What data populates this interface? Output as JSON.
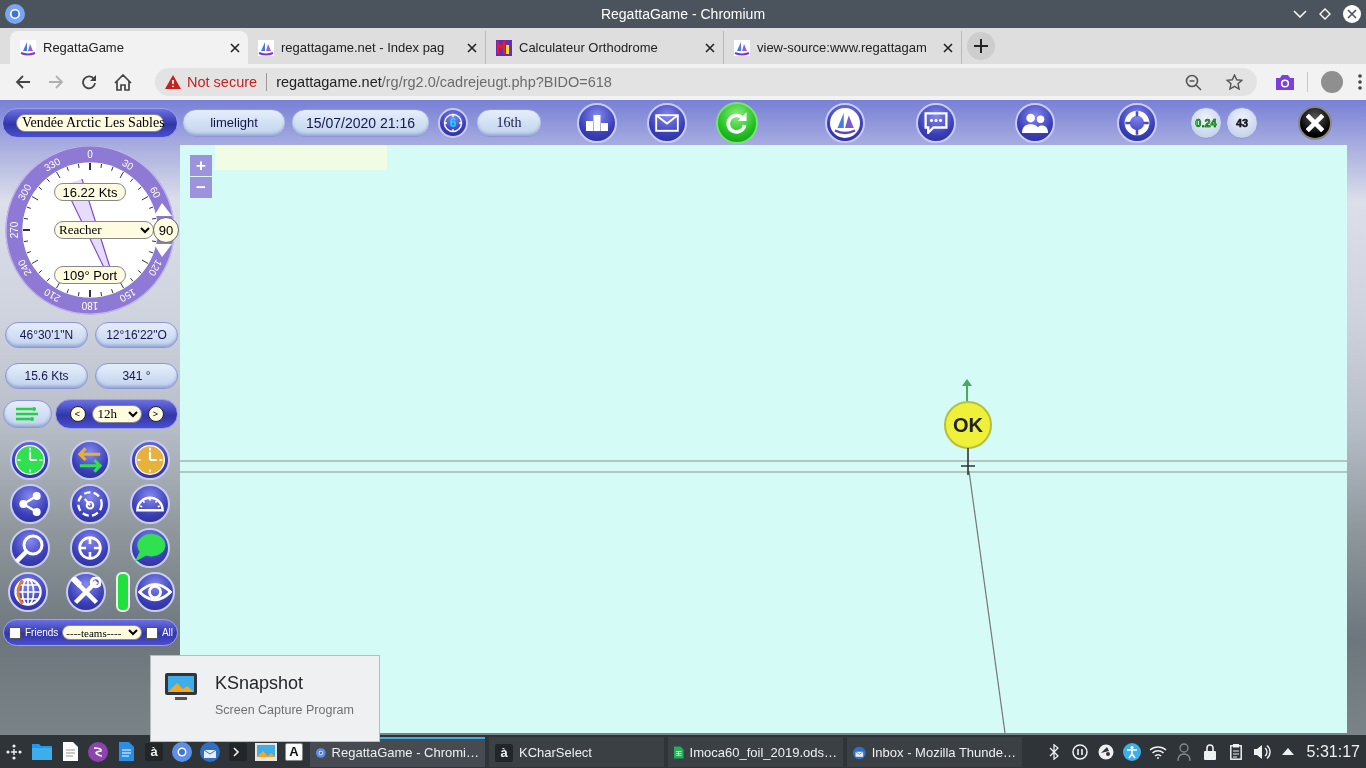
{
  "window": {
    "title": "RegattaGame - Chromium"
  },
  "tabs": [
    {
      "title": "RegattaGame",
      "kind": "sailboat",
      "selected": true
    },
    {
      "title": "regattagame.net - Index pag",
      "kind": "sailboat",
      "selected": false
    },
    {
      "title": "Calculateur Orthodrome",
      "kind": "tile",
      "selected": false
    },
    {
      "title": "view-source:www.regattagam",
      "kind": "sailboat",
      "selected": false
    }
  ],
  "address_bar": {
    "forward_disabled": true,
    "security": "Not secure",
    "url_host": "regattagame.net",
    "url_path": "/rg/rg2.0/cadrejeugt.php?BIDO=618"
  },
  "game_toolbar": {
    "race": "Vendée Arctic Les Sables",
    "player": "limelight",
    "datetime": "15/07/2020 21:16",
    "timer_badge": "6",
    "rank": "16th",
    "buttons": [
      {
        "kind": "podium"
      },
      {
        "kind": "mail"
      },
      {
        "kind": "refresh"
      },
      {
        "kind": "logo"
      },
      {
        "kind": "chat"
      },
      {
        "kind": "people"
      },
      {
        "kind": "lifebuoy"
      },
      {
        "kind": "counter",
        "label": "0.24",
        "color": "#22d822"
      },
      {
        "kind": "counter",
        "label": "43",
        "color": "#1c1c2c"
      },
      {
        "kind": "close"
      }
    ]
  },
  "compass": {
    "degrees": [
      {
        "label": "0"
      },
      {
        "label": "30"
      },
      {
        "label": "60"
      },
      {
        "label": "120"
      },
      {
        "label": "150"
      },
      {
        "label": "180"
      },
      {
        "label": "210"
      },
      {
        "label": "240"
      },
      {
        "label": "270"
      },
      {
        "label": "300"
      },
      {
        "label": "330"
      }
    ],
    "boat_speed": "16.22 Kts",
    "sail": "Reacher",
    "angle_button": "90",
    "wind_angle": "109° Port"
  },
  "position": {
    "latitude": "46°30'1\"N",
    "longitude": "12°16'22\"O"
  },
  "motion": {
    "speed": "15.6 Kts",
    "heading": "341 °"
  },
  "time_nav": {
    "prev": "<",
    "step": "12h",
    "next": ">"
  },
  "tools": [
    [
      {
        "kind": "clock-green"
      },
      {
        "kind": "swap"
      },
      {
        "kind": "clock-orange"
      }
    ],
    [
      {
        "kind": "share"
      },
      {
        "kind": "gauge"
      },
      {
        "kind": "protractor"
      }
    ],
    [
      {
        "kind": "magnifier"
      },
      {
        "kind": "crosshair"
      },
      {
        "kind": "bubble"
      }
    ],
    [
      {
        "kind": "globe"
      },
      {
        "kind": "tools"
      },
      {
        "kind": "indicator"
      },
      {
        "kind": "eye"
      }
    ]
  ],
  "filter": {
    "friends": {
      "label": "Friends",
      "checked": false
    },
    "team": "----teams----",
    "all": {
      "label": "All",
      "checked": false
    }
  },
  "map": {
    "zoom_in": "+",
    "zoom_out": "−",
    "boat_label": "OK"
  },
  "notification": {
    "title": "KSnapshot",
    "subtitle": "Screen Capture Program"
  },
  "taskbar": {
    "launchers": [
      {
        "kind": "menu"
      },
      {
        "kind": "folder"
      },
      {
        "kind": "document"
      },
      {
        "kind": "emacs"
      },
      {
        "kind": "textfile"
      },
      {
        "kind": "glyph-dark",
        "glyph": "à"
      },
      {
        "kind": "chromium"
      },
      {
        "kind": "thunderbird"
      },
      {
        "kind": "terminal"
      },
      {
        "kind": "image"
      },
      {
        "kind": "glyph-light",
        "glyph": "A"
      }
    ],
    "tasks": [
      {
        "title": "RegattaGame - Chromi…",
        "kind": "chromium",
        "selected": true
      },
      {
        "title": "KCharSelect",
        "kind": "glyph-dark",
        "glyph": "à",
        "selected": false
      },
      {
        "title": "Imoca60_foil_2019.ods…",
        "kind": "spreadsheet",
        "selected": false
      },
      {
        "title": "Inbox - Mozilla Thunde…",
        "kind": "thunderbird",
        "selected": false
      }
    ],
    "tray": [
      {
        "kind": "bluetooth"
      },
      {
        "kind": "pause"
      },
      {
        "kind": "disc"
      },
      {
        "kind": "accessibility"
      },
      {
        "kind": "wifi"
      },
      {
        "kind": "user"
      },
      {
        "kind": "lock"
      },
      {
        "kind": "clipboard"
      },
      {
        "kind": "volume"
      },
      {
        "kind": "caret"
      }
    ],
    "clock": "5:31:17"
  }
}
